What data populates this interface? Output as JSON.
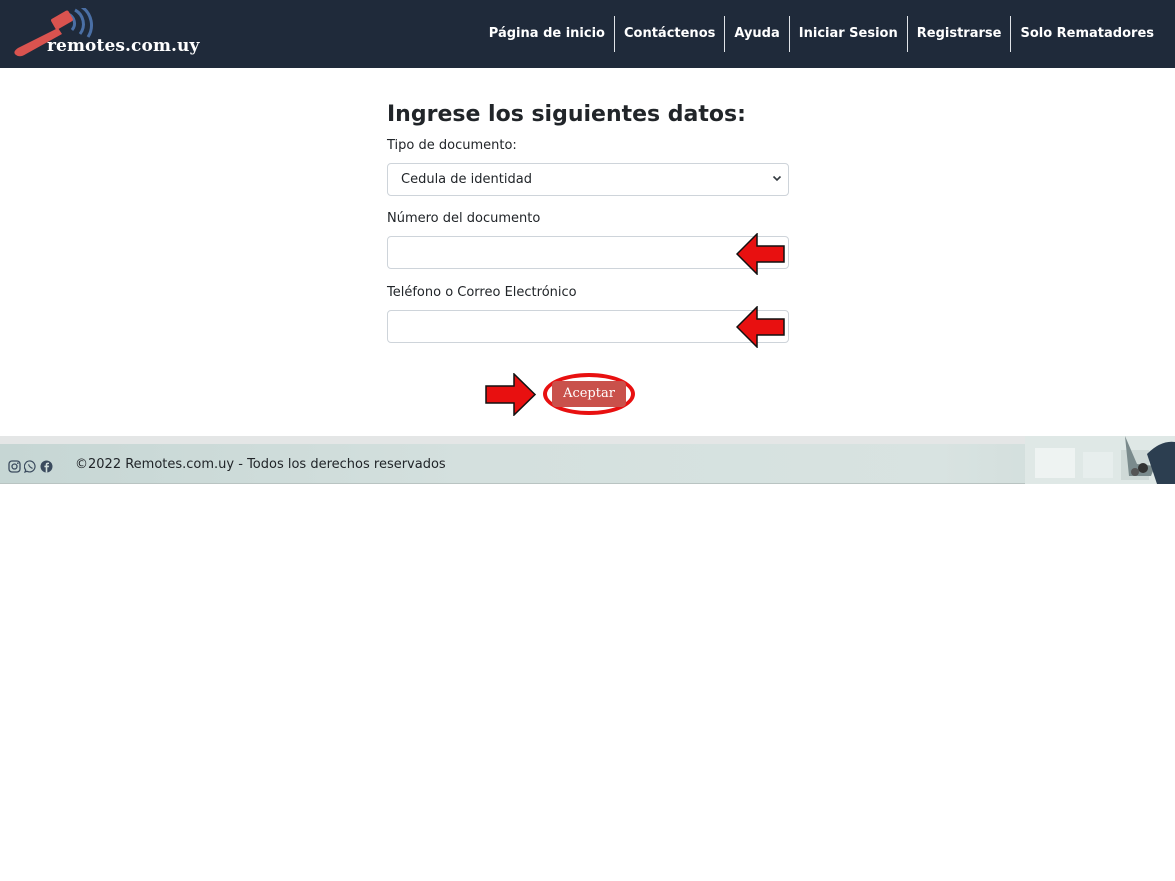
{
  "header": {
    "brand": "remotes.com.uy",
    "nav": [
      {
        "label": "Página de inicio"
      },
      {
        "label": "Contáctenos"
      },
      {
        "label": "Ayuda"
      },
      {
        "label": "Iniciar Sesion"
      },
      {
        "label": "Registrarse"
      },
      {
        "label": "Solo Rematadores"
      }
    ]
  },
  "form": {
    "title": "Ingrese los siguientes datos:",
    "doc_type_label": "Tipo de documento:",
    "doc_type_value": "Cedula de identidad",
    "doc_number_label": "Número del documento",
    "doc_number_value": "",
    "contact_label": "Teléfono o Correo Electrónico",
    "contact_value": "",
    "submit_label": "Aceptar"
  },
  "footer": {
    "copyright": "©2022 Remotes.com.uy - Todos los derechos reservados",
    "social_icons": [
      "instagram-icon",
      "whatsapp-icon",
      "facebook-icon"
    ]
  },
  "colors": {
    "navbar_bg": "#1f2a3a",
    "button_bg": "#c9514b",
    "annotation_red": "#e81010"
  }
}
